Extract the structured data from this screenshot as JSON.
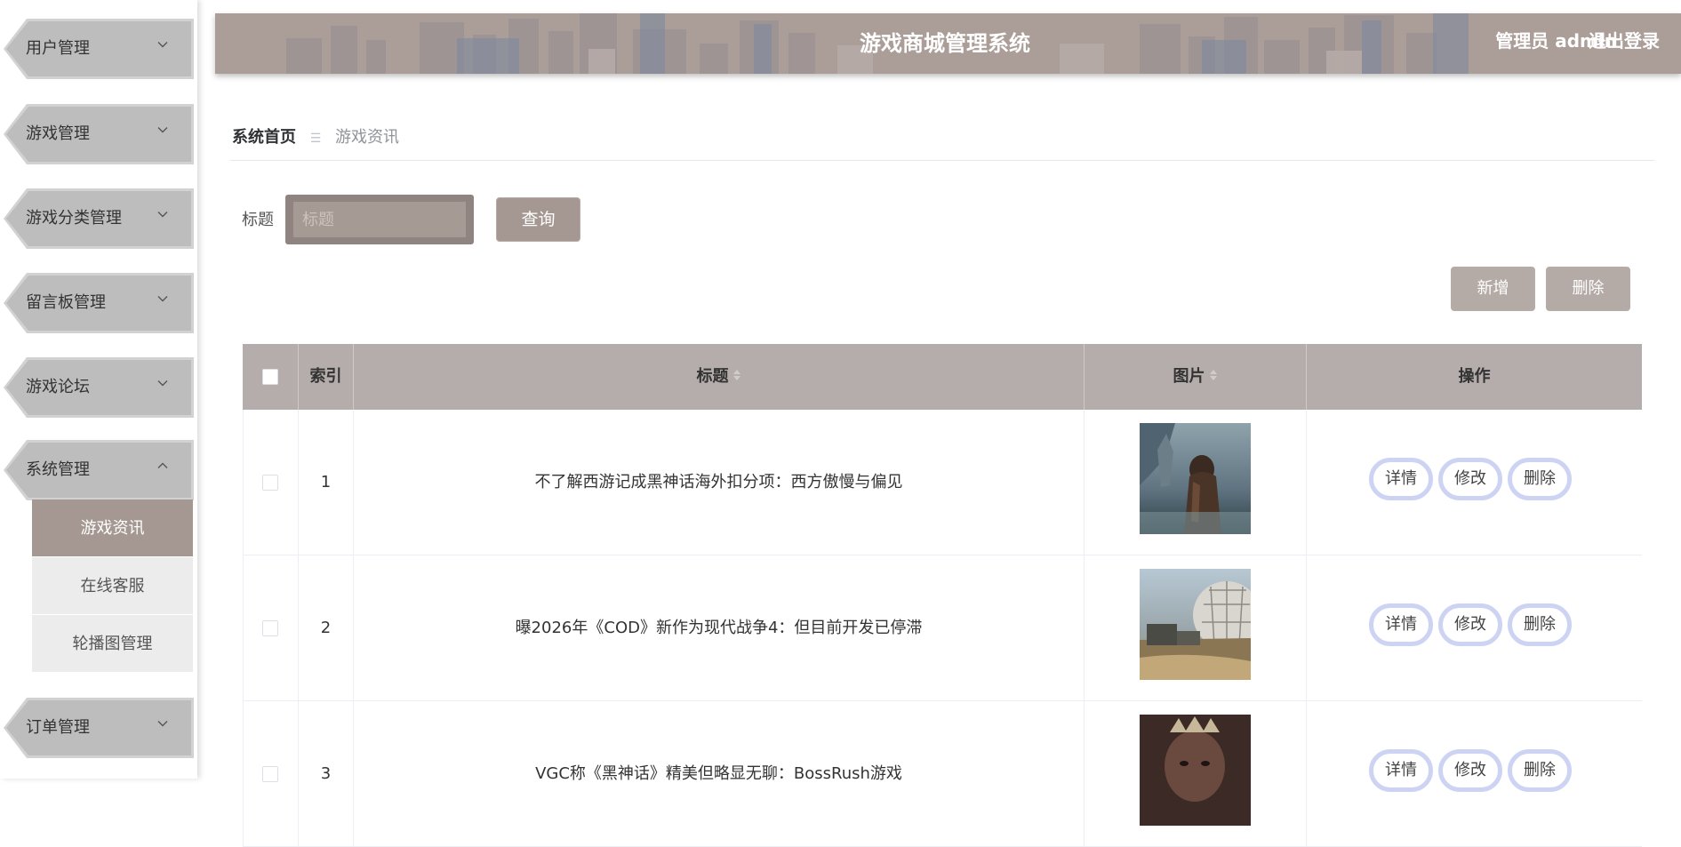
{
  "sidebar": {
    "menus": [
      {
        "label": "用户管理",
        "expanded": false
      },
      {
        "label": "游戏管理",
        "expanded": false
      },
      {
        "label": "游戏分类管理",
        "expanded": false
      },
      {
        "label": "留言板管理",
        "expanded": false
      },
      {
        "label": "游戏论坛",
        "expanded": false
      },
      {
        "label": "系统管理",
        "expanded": true
      },
      {
        "label": "订单管理",
        "expanded": false
      }
    ],
    "submenu": [
      {
        "label": "游戏资讯",
        "active": true
      },
      {
        "label": "在线客服",
        "active": false
      },
      {
        "label": "轮播图管理",
        "active": false
      }
    ]
  },
  "header": {
    "title": "游戏商城管理系统",
    "user": "管理员 admin",
    "logout": "退出登录"
  },
  "breadcrumb": {
    "home": "系统首页",
    "separator": "☰",
    "current": "游戏资讯"
  },
  "search": {
    "label": "标题",
    "placeholder": "标题",
    "value": "",
    "query_button": "查询"
  },
  "actions": {
    "add": "新增",
    "delete": "删除"
  },
  "table": {
    "headers": {
      "index": "索引",
      "title": "标题",
      "image": "图片",
      "operations": "操作"
    },
    "op_labels": {
      "detail": "详情",
      "edit": "修改",
      "delete": "删除"
    },
    "rows": [
      {
        "index": "1",
        "title": "不了解西游记成黑神话海外扣分项：西方傲慢与偏见"
      },
      {
        "index": "2",
        "title": "曝2026年《COD》新作为现代战争4：但目前开发已停滞"
      },
      {
        "index": "3",
        "title": "VGC称《黑神话》精美但略显无聊：BossRush游戏"
      }
    ]
  },
  "colors": {
    "accent": "#a59892",
    "header_bg": "#ab9d97",
    "menu_bg": "#bdbdbd",
    "op_border": "#cdd3f2"
  }
}
